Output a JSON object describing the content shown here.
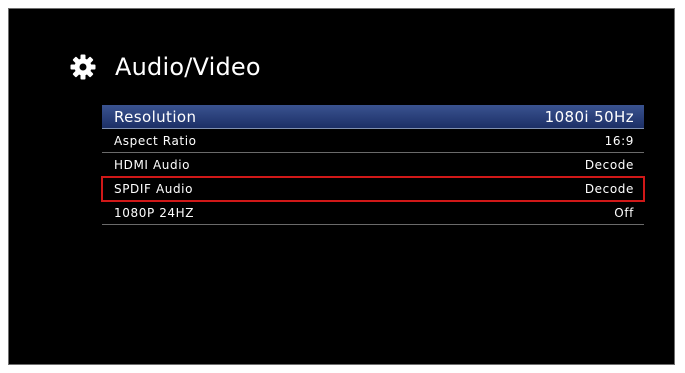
{
  "header": {
    "title": "Audio/Video",
    "icon": "gear-icon"
  },
  "settings": [
    {
      "label": "Resolution",
      "value": "1080i 50Hz",
      "selected": true
    },
    {
      "label": "Aspect Ratio",
      "value": "16:9"
    },
    {
      "label": "HDMI Audio",
      "value": "Decode"
    },
    {
      "label": "SPDIF Audio",
      "value": "Decode",
      "highlighted": true
    },
    {
      "label": "1080P 24HZ",
      "value": "Off"
    }
  ],
  "colors": {
    "background": "#000000",
    "selected_row": "#2a4280",
    "highlight_border": "#d01818"
  }
}
